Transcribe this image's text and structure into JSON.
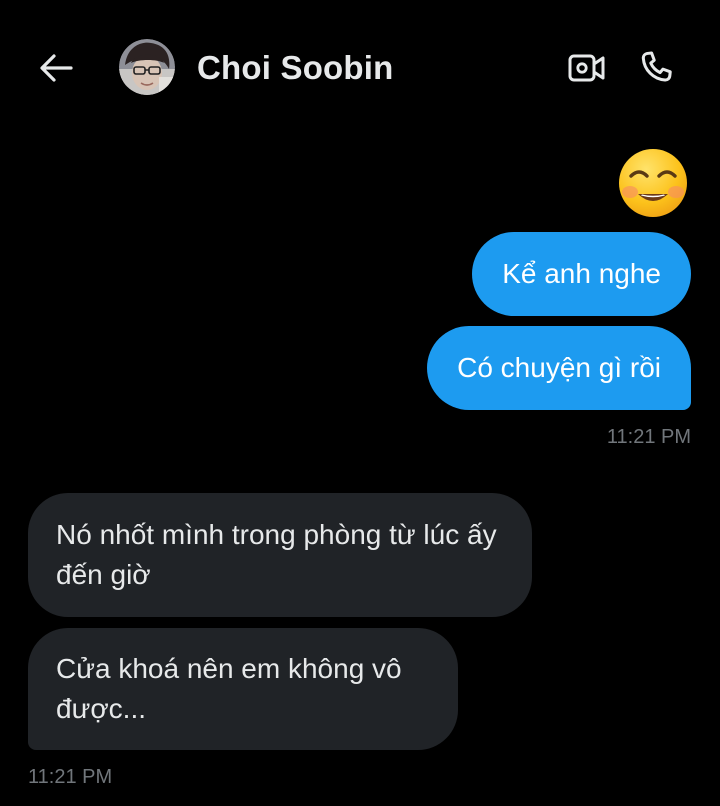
{
  "header": {
    "back_icon": "arrow-left-icon",
    "contact_name": "Choi Soobin",
    "avatar_icon": "avatar-photo",
    "video_icon": "video-camera-icon",
    "call_icon": "phone-icon"
  },
  "messages": {
    "outgoing": [
      {
        "type": "emoji",
        "icon": "smiling-face-with-smiling-eyes-emoji"
      },
      {
        "type": "text",
        "text": "Kể anh nghe"
      },
      {
        "type": "text",
        "text": "Có chuyện gì rồi"
      }
    ],
    "outgoing_time": "11:21 PM",
    "incoming": [
      {
        "type": "text",
        "text": "Nó nhốt mình trong phòng từ lúc ấy đến giờ"
      },
      {
        "type": "text",
        "text": "Cửa khoá nên em không vô được..."
      }
    ],
    "incoming_time": "11:21 PM"
  },
  "colors": {
    "background": "#000000",
    "outgoing_bubble": "#1d9bf0",
    "incoming_bubble": "#202327",
    "primary_text": "#e7e9ea",
    "secondary_text": "#71767b"
  }
}
